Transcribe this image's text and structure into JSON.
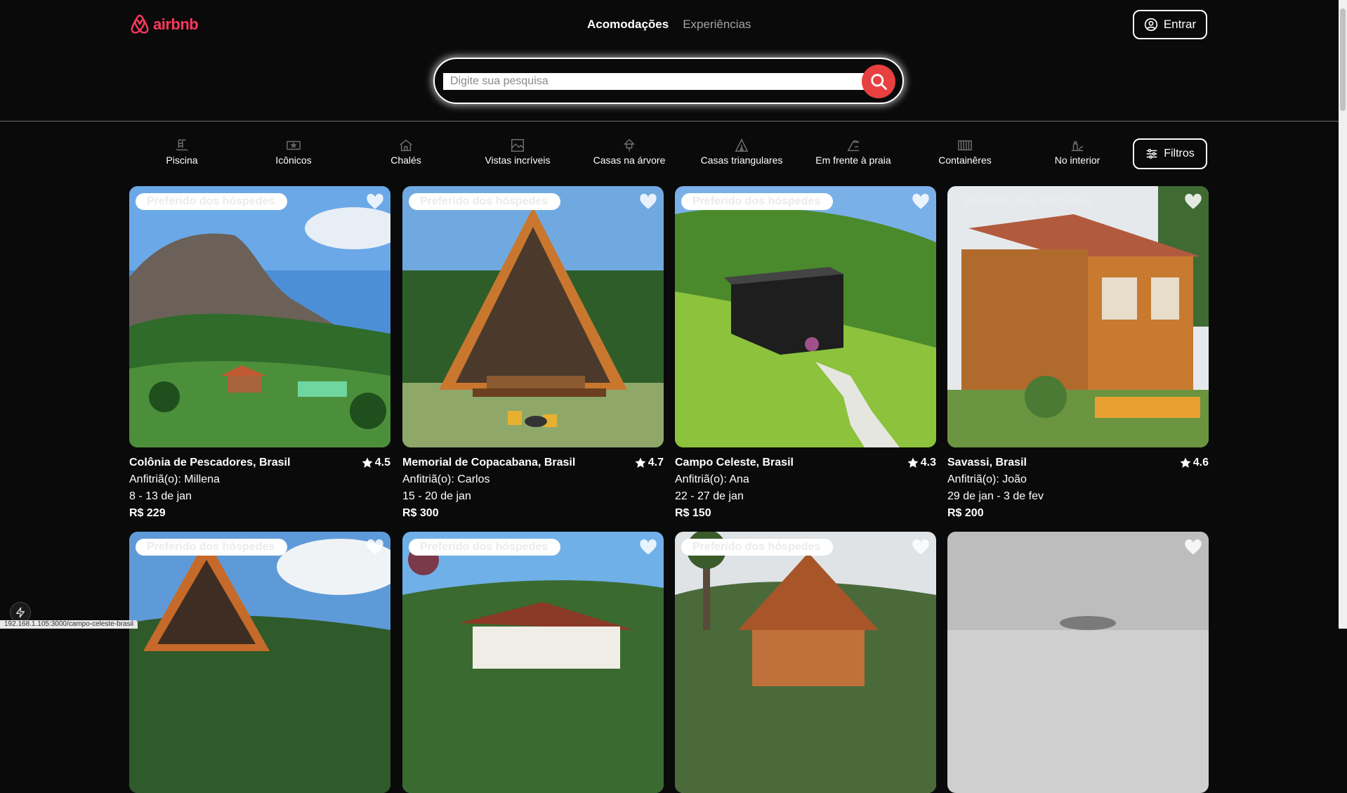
{
  "header": {
    "logo_text": "airbnb",
    "nav": {
      "stays": "Acomodações",
      "experiences": "Experiências"
    },
    "login_label": "Entrar"
  },
  "search": {
    "placeholder": "Digite sua pesquisa"
  },
  "categories": [
    {
      "label": "Piscina",
      "icon": "pool-icon"
    },
    {
      "label": "Icônicos",
      "icon": "ticket-icon"
    },
    {
      "label": "Chalés",
      "icon": "cabin-icon"
    },
    {
      "label": "Vistas incríveis",
      "icon": "view-icon"
    },
    {
      "label": "Casas na árvore",
      "icon": "treehouse-icon"
    },
    {
      "label": "Casas triangulares",
      "icon": "a-frame-icon"
    },
    {
      "label": "Em frente à praia",
      "icon": "beachfront-icon"
    },
    {
      "label": "Containêres",
      "icon": "container-icon"
    },
    {
      "label": "No interior",
      "icon": "countryside-icon"
    }
  ],
  "filters_label": "Filtros",
  "listings": [
    {
      "badge": "Preferido dos hóspedes",
      "title": "Colônia de Pescadores, Brasil",
      "rating": "4.5",
      "host": "Anfitriã(o): Millena",
      "dates": "8 - 13 de jan",
      "price": "R$ 229"
    },
    {
      "badge": "Preferido dos hóspedes",
      "title": "Memorial de Copacabana, Brasil",
      "rating": "4.7",
      "host": "Anfitriã(o): Carlos",
      "dates": "15 - 20 de jan",
      "price": "R$ 300"
    },
    {
      "badge": "Preferido dos hóspedes",
      "title": "Campo Celeste, Brasil",
      "rating": "4.3",
      "host": "Anfitriã(o): Ana",
      "dates": "22 - 27 de jan",
      "price": "R$ 150"
    },
    {
      "badge": "Preferido dos hóspedes",
      "title": "Savassi, Brasil",
      "rating": "4.6",
      "host": "Anfitriã(o): João",
      "dates": "29 de jan - 3 de fev",
      "price": "R$ 200"
    }
  ],
  "row2_badges": [
    "Preferido dos hóspedes",
    "Preferido dos hóspedes",
    "Preferido dos hóspedes"
  ],
  "status_url": "192.168.1.105:3000/campo-celeste-brasil",
  "colors": {
    "brand": "#ff385c",
    "search_button": "#e84040",
    "background": "#0a0a0a"
  }
}
